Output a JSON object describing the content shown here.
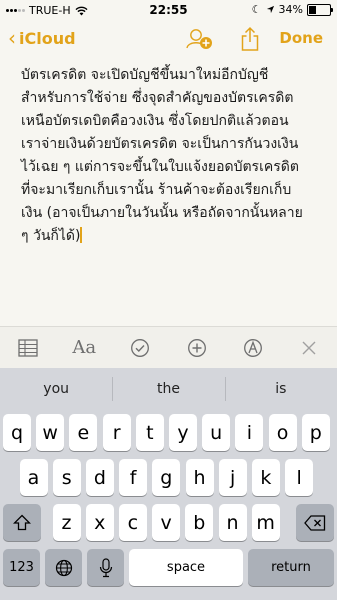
{
  "status": {
    "carrier": "TRUE-H",
    "time": "22:55",
    "battery": "34%",
    "battery_level": 0.34
  },
  "nav": {
    "back_label": "iCloud",
    "done_label": "Done"
  },
  "note": {
    "text": "บัตรเครดิต จะเปิดบัญชีขึ้นมาใหม่อีกบัญชี\nสำหรับการใช้จ่าย ซึ่งจุดสำคัญของบัตรเครดิต\nเหนือบัตรเดบิตคือวงเงิน ซึ่งโดยปกติแล้วตอน\nเราจ่ายเงินด้วยบัตรเครดิต จะเป็นการกันวงเงิน\nไว้เฉย ๆ แต่การจะขึ้นในใบแจ้งยอดบัตรเครดิต\nที่จะมาเรียกเก็บเรานั้น ร้านค้าจะต้องเรียกเก็บ\nเงิน (อาจเป็นภายในวันนั้น หรือถัดจากนั้นหลาย\nๆ วันก็ได้)"
  },
  "toolbar": {
    "format_label": "Aa"
  },
  "keyboard": {
    "suggestions": [
      "you",
      "the",
      "is"
    ],
    "row1": [
      "q",
      "w",
      "e",
      "r",
      "t",
      "y",
      "u",
      "i",
      "o",
      "p"
    ],
    "row2": [
      "a",
      "s",
      "d",
      "f",
      "g",
      "h",
      "j",
      "k",
      "l"
    ],
    "row3": [
      "z",
      "x",
      "c",
      "v",
      "b",
      "n",
      "m"
    ],
    "numbers_label": "123",
    "space_label": "space",
    "return_label": "return"
  },
  "colors": {
    "accent": "#e2a31a",
    "background": "#f7f6f1",
    "keyboard": "#d4d6db"
  }
}
